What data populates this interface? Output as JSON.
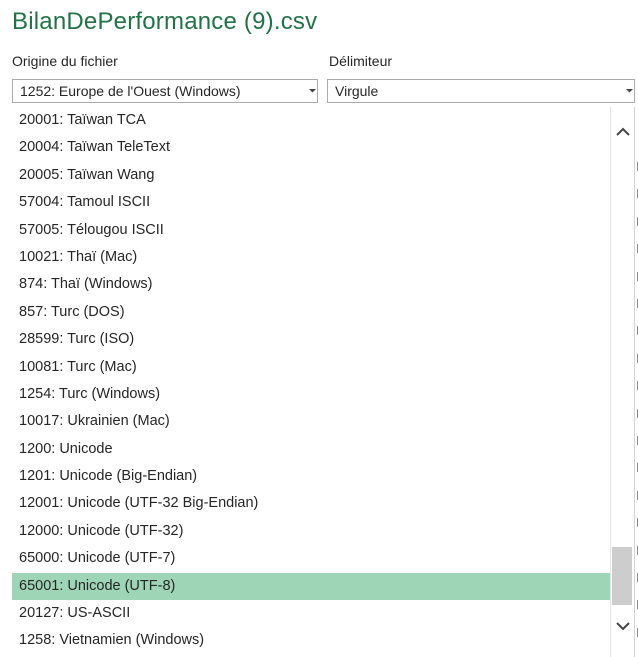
{
  "title": "BilanDePerformance (9).csv",
  "origin": {
    "label": "Origine du fichier",
    "selected": "1252: Europe de l'Ouest (Windows)",
    "options": [
      "20001: Taïwan TCA",
      "20004: Taïwan TeleText",
      "20005: Taïwan Wang",
      "57004: Tamoul ISCII",
      "57005: Télougou ISCII",
      "10021: Thaï (Mac)",
      "874: Thaï (Windows)",
      "857: Turc (DOS)",
      "28599: Turc (ISO)",
      "10081: Turc (Mac)",
      "1254: Turc (Windows)",
      "10017: Ukrainien (Mac)",
      "1200: Unicode",
      "1201: Unicode (Big-Endian)",
      "12001: Unicode (UTF-32 Big-Endian)",
      "12000: Unicode (UTF-32)",
      "65000: Unicode (UTF-7)",
      "65001: Unicode (UTF-8)",
      "20127: US-ASCII",
      "1258: Vietnamien (Windows)"
    ],
    "highlighted": "65001: Unicode (UTF-8)"
  },
  "delimiter": {
    "label": "Délimiteur",
    "selected": "Virgule"
  },
  "icons": {
    "dropdown": "chevron-down-icon",
    "scroll_up": "chevron-up-icon",
    "scroll_down": "chevron-down-icon"
  },
  "colors": {
    "title": "#217346",
    "highlight": "#9fd5b7"
  }
}
